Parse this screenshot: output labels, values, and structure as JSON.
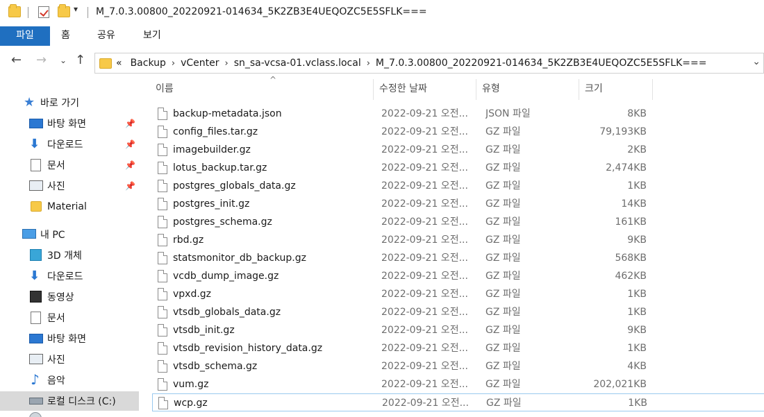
{
  "window": {
    "title": "M_7.0.3.00800_20220921-014634_5K2ZB3E4UEQOZC5E5SFLK==="
  },
  "ribbon": {
    "tabs": [
      "파일",
      "홈",
      "공유",
      "보기"
    ]
  },
  "address": {
    "overflow": "«",
    "crumbs": [
      "Backup",
      "vCenter",
      "sn_sa-vcsa-01.vclass.local",
      "M_7.0.3.00800_20220921-014634_5K2ZB3E4UEQOZC5E5SFLK==="
    ]
  },
  "nav": {
    "items": [
      {
        "label": "바로 가기",
        "icon": "star-icon"
      },
      {
        "label": "바탕 화면",
        "icon": "desktop-icon",
        "pinned": true
      },
      {
        "label": "다운로드",
        "icon": "download-icon",
        "pinned": true
      },
      {
        "label": "문서",
        "icon": "document-icon",
        "pinned": true
      },
      {
        "label": "사진",
        "icon": "pictures-icon",
        "pinned": true
      },
      {
        "label": "Material",
        "icon": "folder-icon"
      },
      {
        "label": "내 PC",
        "icon": "pc-icon"
      },
      {
        "label": "3D 개체",
        "icon": "3d-objects-icon"
      },
      {
        "label": "다운로드",
        "icon": "download-icon"
      },
      {
        "label": "동영상",
        "icon": "video-icon"
      },
      {
        "label": "문서",
        "icon": "document-icon"
      },
      {
        "label": "바탕 화면",
        "icon": "desktop-icon"
      },
      {
        "label": "사진",
        "icon": "pictures-icon"
      },
      {
        "label": "음악",
        "icon": "music-icon"
      },
      {
        "label": "로컬 디스크 (C:)",
        "icon": "local-disk-icon",
        "selected": true
      }
    ]
  },
  "columns": {
    "name": "이름",
    "date": "수정한 날짜",
    "type": "유형",
    "size": "크기"
  },
  "files": [
    {
      "name": "backup-metadata.json",
      "date": "2022-09-21 오전...",
      "type": "JSON 파일",
      "size": "8KB"
    },
    {
      "name": "config_files.tar.gz",
      "date": "2022-09-21 오전...",
      "type": "GZ 파일",
      "size": "79,193KB"
    },
    {
      "name": "imagebuilder.gz",
      "date": "2022-09-21 오전...",
      "type": "GZ 파일",
      "size": "2KB"
    },
    {
      "name": "lotus_backup.tar.gz",
      "date": "2022-09-21 오전...",
      "type": "GZ 파일",
      "size": "2,474KB"
    },
    {
      "name": "postgres_globals_data.gz",
      "date": "2022-09-21 오전...",
      "type": "GZ 파일",
      "size": "1KB"
    },
    {
      "name": "postgres_init.gz",
      "date": "2022-09-21 오전...",
      "type": "GZ 파일",
      "size": "14KB"
    },
    {
      "name": "postgres_schema.gz",
      "date": "2022-09-21 오전...",
      "type": "GZ 파일",
      "size": "161KB"
    },
    {
      "name": "rbd.gz",
      "date": "2022-09-21 오전...",
      "type": "GZ 파일",
      "size": "9KB"
    },
    {
      "name": "statsmonitor_db_backup.gz",
      "date": "2022-09-21 오전...",
      "type": "GZ 파일",
      "size": "568KB"
    },
    {
      "name": "vcdb_dump_image.gz",
      "date": "2022-09-21 오전...",
      "type": "GZ 파일",
      "size": "462KB"
    },
    {
      "name": "vpxd.gz",
      "date": "2022-09-21 오전...",
      "type": "GZ 파일",
      "size": "1KB"
    },
    {
      "name": "vtsdb_globals_data.gz",
      "date": "2022-09-21 오전...",
      "type": "GZ 파일",
      "size": "1KB"
    },
    {
      "name": "vtsdb_init.gz",
      "date": "2022-09-21 오전...",
      "type": "GZ 파일",
      "size": "9KB"
    },
    {
      "name": "vtsdb_revision_history_data.gz",
      "date": "2022-09-21 오전...",
      "type": "GZ 파일",
      "size": "1KB"
    },
    {
      "name": "vtsdb_schema.gz",
      "date": "2022-09-21 오전...",
      "type": "GZ 파일",
      "size": "4KB"
    },
    {
      "name": "vum.gz",
      "date": "2022-09-21 오전...",
      "type": "GZ 파일",
      "size": "202,021KB"
    },
    {
      "name": "wcp.gz",
      "date": "2022-09-21 오전...",
      "type": "GZ 파일",
      "size": "1KB",
      "focused": true
    }
  ],
  "colors": {
    "accent": "#1f6fc0",
    "selection": "#d9d9d9",
    "focus_border": "#99c9ef",
    "folder": "#f7c948"
  }
}
